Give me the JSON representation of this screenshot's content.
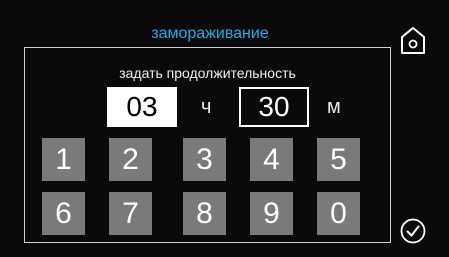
{
  "header": {
    "title": "замораживание",
    "home_icon": "home-icon"
  },
  "panel": {
    "subtitle": "задать продолжительность",
    "hours": {
      "value": "03",
      "unit": "ч"
    },
    "minutes": {
      "value": "30",
      "unit": "м"
    }
  },
  "keypad": {
    "keys": [
      "1",
      "2",
      "3",
      "4",
      "5",
      "6",
      "7",
      "8",
      "9",
      "0"
    ]
  },
  "confirm_icon": "checkmark-circle-icon",
  "colors": {
    "accent": "#29abe2",
    "key": "#7a7a7a",
    "background": "#0a0a0a"
  }
}
